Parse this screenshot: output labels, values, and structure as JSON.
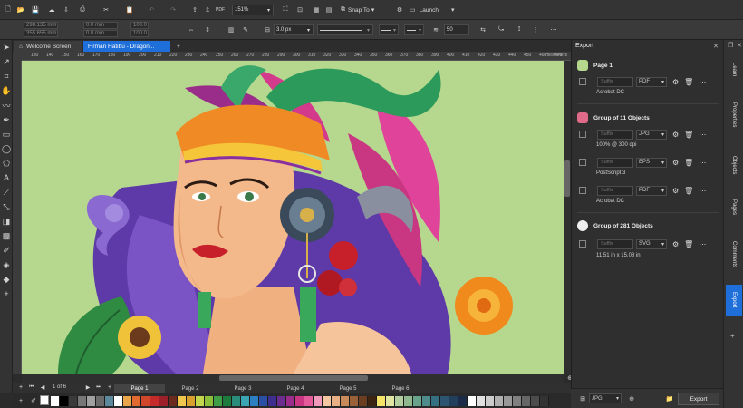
{
  "topbar": {
    "zoom": "151%",
    "snap_label": "Snap To",
    "launch_label": "Launch"
  },
  "propbar": {
    "x": "298.135 mm",
    "y": "355.655 mm",
    "w": "0.0 mm",
    "h": "0.0 mm",
    "sx": "100.0",
    "sy": "100.0",
    "outline_width": "3.0 px",
    "smooth_value": "50"
  },
  "tabs": [
    {
      "label": "Welcome Screen",
      "active": false
    },
    {
      "label": "Firman Hatibu - Dragon...",
      "active": true
    }
  ],
  "ruler": {
    "unit": "millimeters",
    "ticks": [
      "130",
      "140",
      "150",
      "160",
      "170",
      "180",
      "190",
      "200",
      "210",
      "220",
      "230",
      "240",
      "250",
      "260",
      "270",
      "280",
      "290",
      "300",
      "310",
      "320",
      "330",
      "340",
      "350",
      "360",
      "370",
      "380",
      "390",
      "400",
      "410",
      "420",
      "430",
      "440",
      "450",
      "460",
      "470"
    ]
  },
  "pages": {
    "counter": "1  of 6",
    "tabs": [
      "Page 1",
      "Page 2",
      "Page 3",
      "Page 4",
      "Page 5",
      "Page 6"
    ]
  },
  "palette": [
    "#ffffff",
    "#000000",
    "#3a3a3a",
    "#777777",
    "#a0a0a0",
    "#6b6b6b",
    "#5c8a9c",
    "#ffffff",
    "#e9a64b",
    "#e06a2f",
    "#d0472c",
    "#c62b2b",
    "#9c1f2a",
    "#6a2a1d",
    "#f0c64c",
    "#d8a12d",
    "#c4d64c",
    "#8bbf3c",
    "#3f9e46",
    "#1d7c3d",
    "#2a8c7a",
    "#3aa6b4",
    "#2c7fc0",
    "#2a4fa5",
    "#3e2f8f",
    "#6b2d8e",
    "#9b2d8a",
    "#c93682",
    "#e35b9a",
    "#f09abb",
    "#f4c6a2",
    "#e8b084",
    "#c88a5a",
    "#9a6138",
    "#6a3e1f",
    "#3d2412",
    "#f6e36a",
    "#e0e5a2",
    "#b3cfa0",
    "#8fb88e",
    "#6aa38c",
    "#4d8c8b",
    "#356f82",
    "#2b5570",
    "#213f5c",
    "#1b2b47",
    "#ffffff",
    "#e0e0e0",
    "#cccccc",
    "#b0b0b0",
    "#999999",
    "#808080",
    "#666666",
    "#4c4c4c",
    "#333333"
  ],
  "export_panel": {
    "title": "Export",
    "groups": [
      {
        "title": "Page 1",
        "rows": [
          {
            "suffix_placeholder": "Suffix",
            "format": "PDF",
            "details": "Acrobat DC"
          }
        ]
      },
      {
        "title": "Group of 11 Objects",
        "rows": [
          {
            "suffix_placeholder": "Suffix",
            "format": "JPG",
            "details": "100% @ 300 dpi"
          },
          {
            "suffix_placeholder": "Suffix",
            "format": "EPS",
            "details": "PostScript 3"
          },
          {
            "suffix_placeholder": "Suffix",
            "format": "PDF",
            "details": "Acrobat DC"
          }
        ]
      },
      {
        "title": "Group of 281 Objects",
        "rows": [
          {
            "suffix_placeholder": "Suffix",
            "format": "SVG",
            "details": "11.51 in x 15.08 in"
          }
        ]
      }
    ],
    "footer_format": "JPG",
    "export_button": "Export"
  },
  "dock_tabs": [
    "Learn",
    "Properties",
    "Objects",
    "Pages",
    "Comments",
    "Export"
  ]
}
